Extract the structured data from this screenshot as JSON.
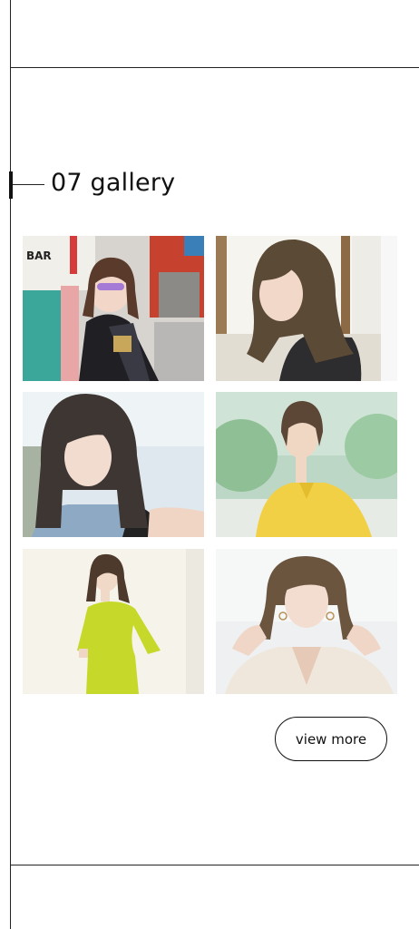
{
  "section": {
    "title": "07 gallery"
  },
  "gallery": {
    "photos": [
      {
        "name": "photo-street-sunglasses",
        "bg": "#c9cfd6"
      },
      {
        "name": "photo-long-hair-window",
        "bg": "#e7e4dd"
      },
      {
        "name": "photo-bob-hair-blue",
        "bg": "#d8e2ea"
      },
      {
        "name": "photo-yellow-blouse-outdoor",
        "bg": "#b9d1bf"
      },
      {
        "name": "photo-lime-dress",
        "bg": "#f3f1e6"
      },
      {
        "name": "photo-hands-in-hair",
        "bg": "#e9ecee"
      }
    ]
  },
  "actions": {
    "view_more_label": "view more"
  },
  "colors": {
    "line": "#222222",
    "text": "#111111",
    "background": "#ffffff"
  }
}
